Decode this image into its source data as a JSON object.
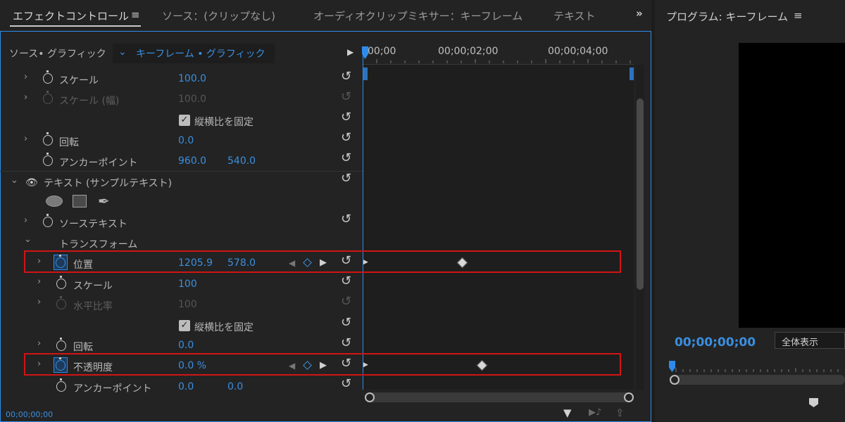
{
  "tabs": [
    {
      "label": "エフェクトコントロール"
    },
    {
      "label": "ソース：(クリップなし)"
    },
    {
      "label": "オーディオクリップミキサー：キーフレーム"
    },
    {
      "label": "テキスト"
    }
  ],
  "overflow_label": "»",
  "menu_glyph": "≡",
  "program": {
    "title": "プログラム: キーフレーム",
    "timecode": "00;00;00;00",
    "zoom": "全体表示"
  },
  "header": {
    "source": "ソース• グラフィック",
    "sequence": "キーフレーム • グラフィック"
  },
  "ruler": {
    "t0": "00;00",
    "t1": "00;00;02;00",
    "t2": "00;00;04;00"
  },
  "props": {
    "scale": {
      "label": "スケール",
      "value": "100.0"
    },
    "scale_w": {
      "label": "スケール (幅)",
      "value": "100.0"
    },
    "uniform1": {
      "label": "縦横比を固定"
    },
    "rotation": {
      "label": "回転",
      "value": "0.0"
    },
    "anchor": {
      "label": "アンカーポイント",
      "x": "960.0",
      "y": "540.0"
    },
    "text_layer": {
      "label": "テキスト (サンプルテキスト)"
    },
    "source_text": {
      "label": "ソーステキスト"
    },
    "transform": {
      "label": "トランスフォーム"
    },
    "position": {
      "label": "位置",
      "x": "1205.9",
      "y": "578.0"
    },
    "t_scale": {
      "label": "スケール",
      "value": "100"
    },
    "t_hscale": {
      "label": "水平比率",
      "value": "100"
    },
    "uniform2": {
      "label": "縦横比を固定"
    },
    "t_rotation": {
      "label": "回転",
      "value": "0.0"
    },
    "opacity": {
      "label": "不透明度",
      "value": "0.0 %"
    },
    "t_anchor": {
      "label": "アンカーポイント",
      "x": "0.0",
      "y": "0.0"
    }
  },
  "bottom_timecode": "00;00;00;00",
  "colors": {
    "accent": "#2d8ceb",
    "highlight": "#d21414"
  }
}
